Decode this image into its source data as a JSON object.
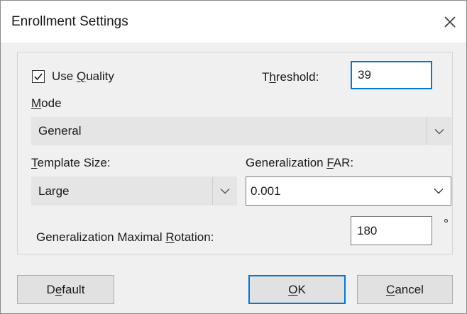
{
  "window": {
    "title": "Enrollment Settings",
    "close_icon": "close-icon"
  },
  "quality": {
    "checked": true,
    "label_pre": "Use ",
    "label_mnemonic": "Q",
    "label_post": "uality"
  },
  "threshold": {
    "label_pre": "T",
    "label_mnemonic": "h",
    "label_post": "reshold:",
    "value": "39"
  },
  "mode": {
    "label_mnemonic": "M",
    "label_post": "ode",
    "value": "General"
  },
  "template_size": {
    "label_mnemonic": "T",
    "label_post": "emplate Size:",
    "value": "Large"
  },
  "generalization_far": {
    "label_pre": "Generalization ",
    "label_mnemonic": "F",
    "label_post": "AR:",
    "value": "0.001"
  },
  "max_rotation": {
    "label_pre": "Generalization Maximal ",
    "label_mnemonic": "R",
    "label_post": "otation:",
    "value": "180",
    "unit": "degree-symbol"
  },
  "buttons": {
    "default": {
      "pre": "D",
      "mnemonic": "e",
      "post": "fault"
    },
    "ok": {
      "mnemonic": "O",
      "post": "K"
    },
    "cancel": {
      "mnemonic": "C",
      "post": "ancel"
    }
  },
  "colors": {
    "accent": "#0078d7",
    "dialog_bg": "#f0f0f0",
    "combo_bg": "#e5e5e5",
    "button_bg": "#e1e1e1"
  }
}
